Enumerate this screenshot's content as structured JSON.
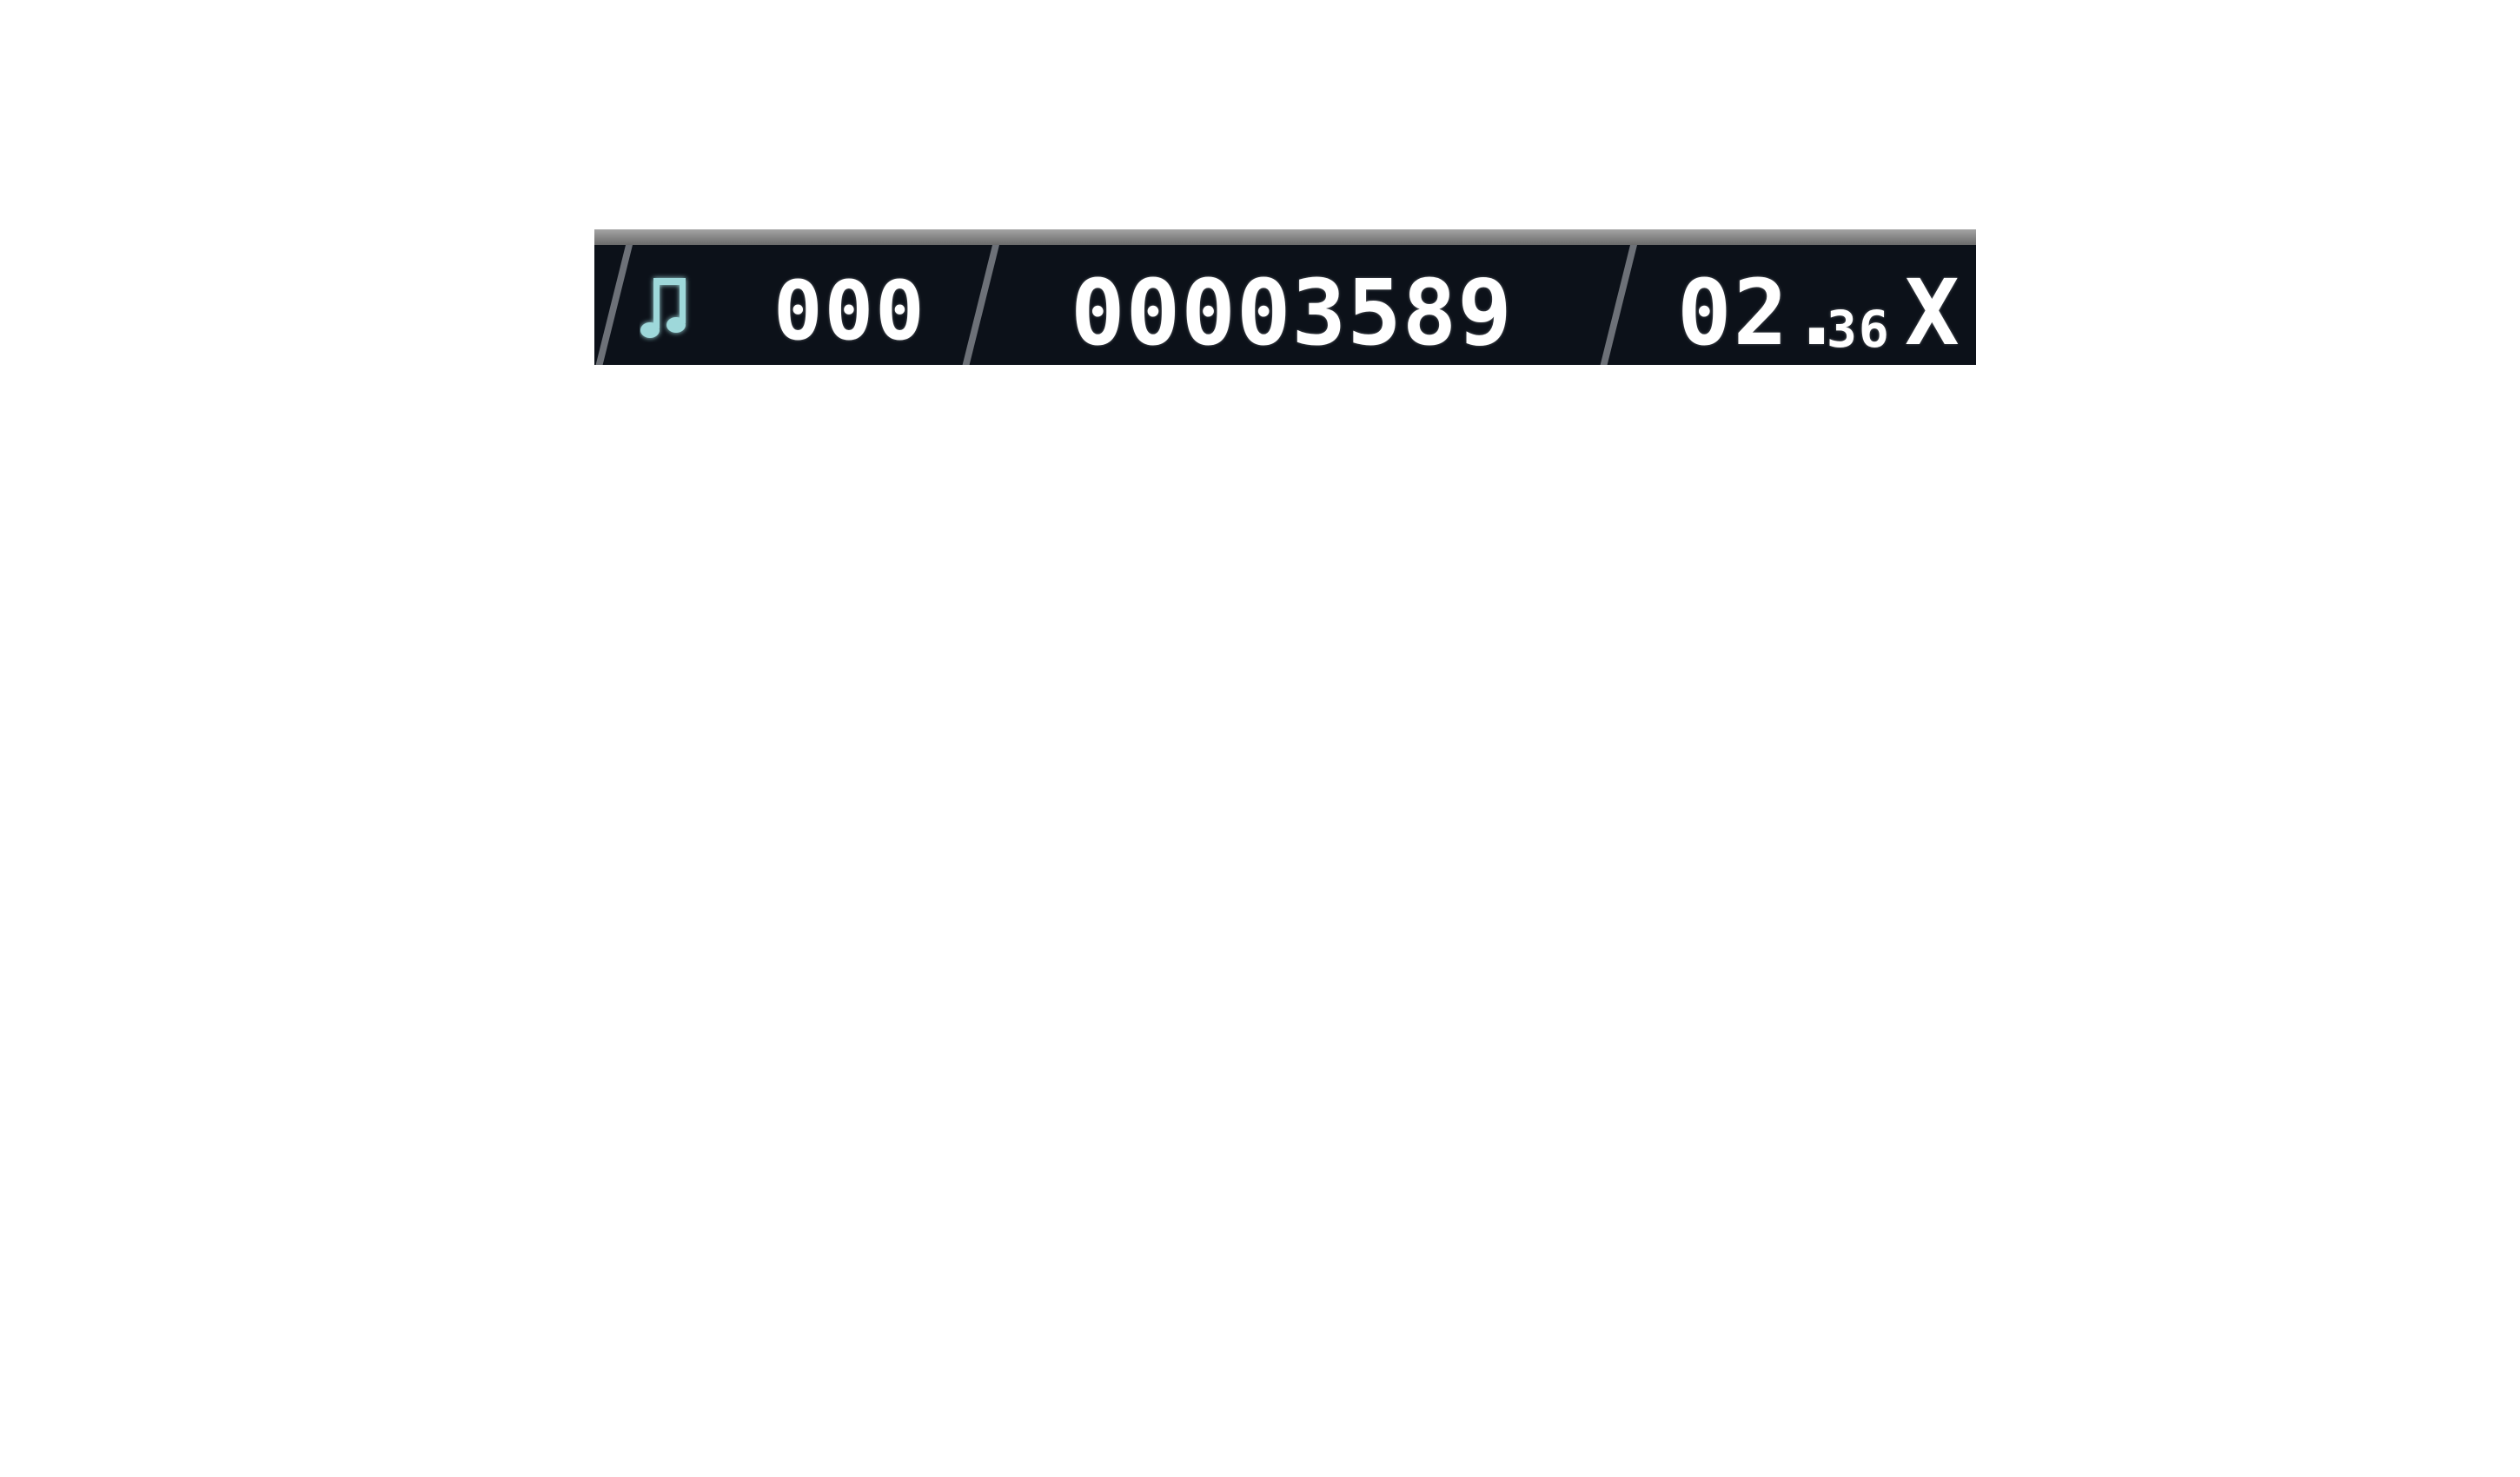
{
  "hud": {
    "note_icon": "music-note-icon",
    "combo": "000",
    "score": "00003589",
    "multiplier_int": "02.",
    "multiplier_frac": "36",
    "multiplier_suffix": "X"
  },
  "colors": {
    "bar_background": "#0c1119",
    "top_strip": "#8a8a8a",
    "divider": "#6d7178",
    "digits": "#ffffff",
    "note_icon": "#9ed8da"
  }
}
